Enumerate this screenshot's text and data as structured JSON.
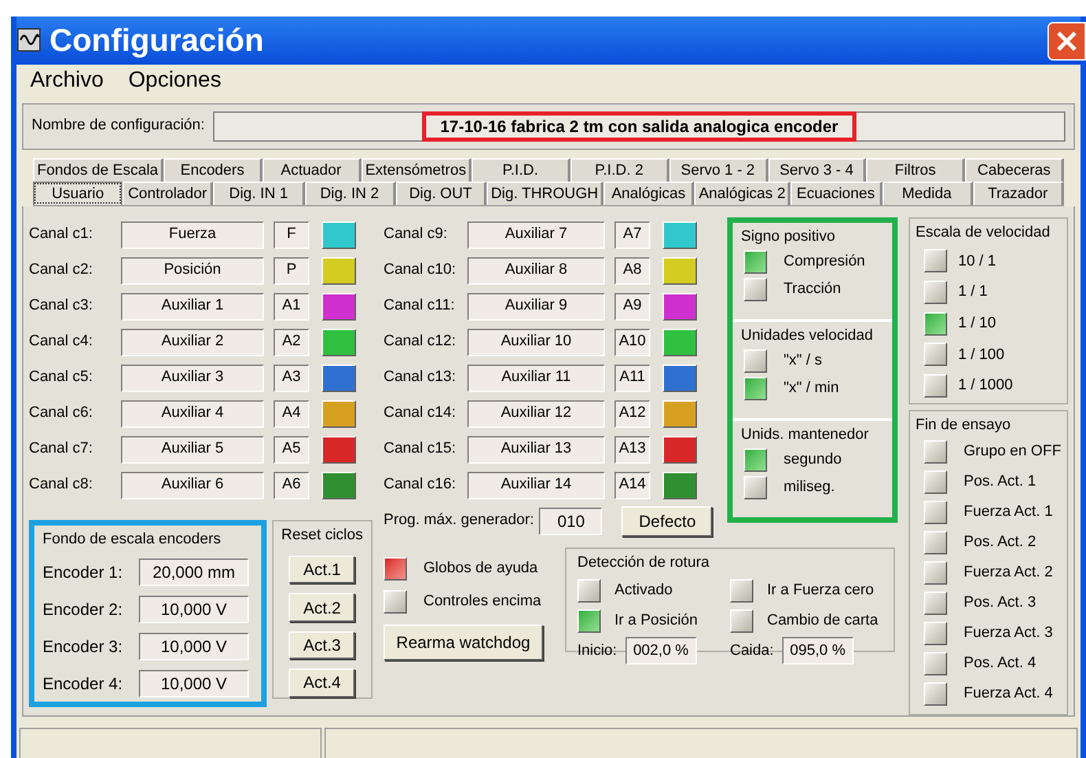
{
  "window": {
    "title": "Configuración"
  },
  "menu": [
    "Archivo",
    "Opciones"
  ],
  "config_name": {
    "label": "Nombre de configuración:",
    "value": "17-10-16 fabrica 2 tm con salida analogica encoder"
  },
  "tab_rows": [
    [
      {
        "label": "Fondos de Escala",
        "selected": false
      },
      {
        "label": "Encoders",
        "selected": false
      },
      {
        "label": "Actuador",
        "selected": false
      },
      {
        "label": "Extensómetros",
        "selected": false
      },
      {
        "label": "P.I.D.",
        "selected": false
      },
      {
        "label": "P.I.D. 2",
        "selected": false
      },
      {
        "label": "Servo 1 - 2",
        "selected": false
      },
      {
        "label": "Servo 3 - 4",
        "selected": false
      },
      {
        "label": "Filtros",
        "selected": false
      },
      {
        "label": "Cabeceras",
        "selected": false
      }
    ],
    [
      {
        "label": "Usuario",
        "selected": true
      },
      {
        "label": "Controlador",
        "selected": false
      },
      {
        "label": "Dig. IN 1",
        "selected": false
      },
      {
        "label": "Dig. IN 2",
        "selected": false
      },
      {
        "label": "Dig. OUT",
        "selected": false
      },
      {
        "label": "Dig. THROUGH",
        "selected": false
      },
      {
        "label": "Analógicas",
        "selected": false
      },
      {
        "label": "Analógicas 2",
        "selected": false
      },
      {
        "label": "Ecuaciones",
        "selected": false
      },
      {
        "label": "Medida",
        "selected": false
      },
      {
        "label": "Trazador",
        "selected": false
      }
    ]
  ],
  "channels": [
    {
      "label": "Canal c1:",
      "name": "Fuerza",
      "short": "F",
      "color": "#30c8cc"
    },
    {
      "label": "Canal c2:",
      "name": "Posición",
      "short": "P",
      "color": "#d4cc20"
    },
    {
      "label": "Canal c3:",
      "name": "Auxiliar 1",
      "short": "A1",
      "color": "#d030d0"
    },
    {
      "label": "Canal c4:",
      "name": "Auxiliar 2",
      "short": "A2",
      "color": "#30c040"
    },
    {
      "label": "Canal c5:",
      "name": "Auxiliar 3",
      "short": "A3",
      "color": "#3070d0"
    },
    {
      "label": "Canal c6:",
      "name": "Auxiliar 4",
      "short": "A4",
      "color": "#d8a020"
    },
    {
      "label": "Canal c7:",
      "name": "Auxiliar 5",
      "short": "A5",
      "color": "#d82828"
    },
    {
      "label": "Canal c8:",
      "name": "Auxiliar 6",
      "short": "A6",
      "color": "#309030"
    },
    {
      "label": "Canal c9:",
      "name": "Auxiliar 7",
      "short": "A7",
      "color": "#30c8cc"
    },
    {
      "label": "Canal c10:",
      "name": "Auxiliar 8",
      "short": "A8",
      "color": "#d4cc20"
    },
    {
      "label": "Canal c11:",
      "name": "Auxiliar 9",
      "short": "A9",
      "color": "#d030d0"
    },
    {
      "label": "Canal c12:",
      "name": "Auxiliar 10",
      "short": "A10",
      "color": "#30c040"
    },
    {
      "label": "Canal c13:",
      "name": "Auxiliar 11",
      "short": "A11",
      "color": "#3070d0"
    },
    {
      "label": "Canal c14:",
      "name": "Auxiliar 12",
      "short": "A12",
      "color": "#d8a020"
    },
    {
      "label": "Canal c15:",
      "name": "Auxiliar 13",
      "short": "A13",
      "color": "#d82828"
    },
    {
      "label": "Canal c16:",
      "name": "Auxiliar 14",
      "short": "A14",
      "color": "#309030"
    }
  ],
  "encoder_scale": {
    "title": "Fondo de escala encoders",
    "items": [
      {
        "label": "Encoder 1:",
        "value": "20,000 mm"
      },
      {
        "label": "Encoder 2:",
        "value": "10,000 V"
      },
      {
        "label": "Encoder 3:",
        "value": "10,000 V"
      },
      {
        "label": "Encoder 4:",
        "value": "10,000 V"
      }
    ]
  },
  "reset_cycles": {
    "title": "Reset ciclos",
    "buttons": [
      "Act.1",
      "Act.2",
      "Act.3",
      "Act.4"
    ]
  },
  "generator": {
    "label": "Prog. máx. generador:",
    "value": "010",
    "button": "Defecto"
  },
  "options": [
    {
      "label": "Globos de ayuda",
      "checked": true
    },
    {
      "label": "Controles encima",
      "checked": false
    }
  ],
  "rearm_button": "Rearma watchdog",
  "break_detection": {
    "title": "Detección de rotura",
    "checks": [
      {
        "label": "Activado",
        "checked": false
      },
      {
        "label": "Ir a Fuerza cero",
        "checked": false
      },
      {
        "label": "Ir a Posición",
        "checked": true
      },
      {
        "label": "Cambio de carta",
        "checked": false
      }
    ],
    "start": {
      "label": "Inicio:",
      "value": "002,0 %"
    },
    "drop": {
      "label": "Caida:",
      "value": "095,0 %"
    }
  },
  "positive_sign": {
    "title": "Signo positivo",
    "options": [
      {
        "label": "Compresión",
        "selected": true
      },
      {
        "label": "Tracción",
        "selected": false
      }
    ]
  },
  "speed_units": {
    "title": "Unidades velocidad",
    "options": [
      {
        "label": "\"x\" / s",
        "selected": false
      },
      {
        "label": "\"x\" / min",
        "selected": true
      }
    ]
  },
  "holder_units": {
    "title": "Unids. mantenedor",
    "options": [
      {
        "label": "segundo",
        "selected": true
      },
      {
        "label": "miliseg.",
        "selected": false
      }
    ]
  },
  "speed_scale": {
    "title": "Escala de velocidad",
    "options": [
      {
        "label": "10 / 1",
        "selected": false
      },
      {
        "label": "1 / 1",
        "selected": false
      },
      {
        "label": "1 / 10",
        "selected": true
      },
      {
        "label": "1 / 100",
        "selected": false
      },
      {
        "label": "1 / 1000",
        "selected": false
      }
    ]
  },
  "test_end": {
    "title": "Fin de ensayo",
    "checks": [
      {
        "label": "Grupo en OFF",
        "checked": false
      },
      {
        "label": "Pos. Act. 1",
        "checked": false
      },
      {
        "label": "Fuerza Act. 1",
        "checked": false
      },
      {
        "label": "Pos. Act. 2",
        "checked": false
      },
      {
        "label": "Fuerza Act. 2",
        "checked": false
      },
      {
        "label": "Pos. Act. 3",
        "checked": false
      },
      {
        "label": "Fuerza Act. 3",
        "checked": false
      },
      {
        "label": "Pos. Act. 4",
        "checked": false
      },
      {
        "label": "Fuerza Act. 4",
        "checked": false
      }
    ]
  }
}
